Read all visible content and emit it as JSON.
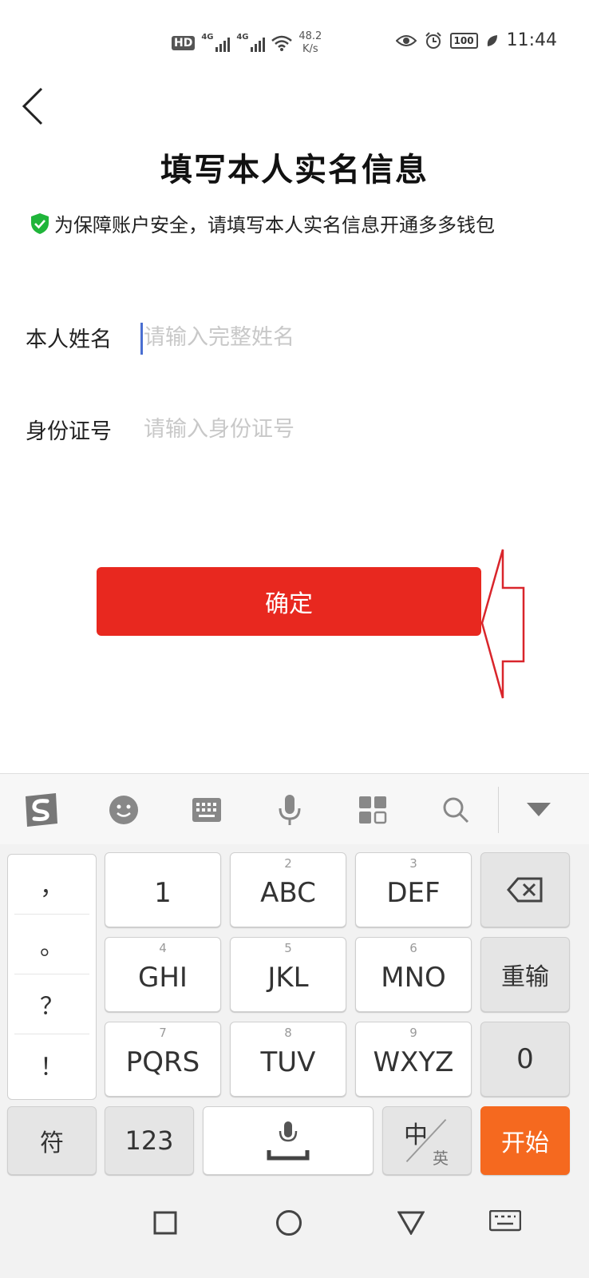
{
  "status_bar": {
    "hd": "HD",
    "net1": "4G",
    "net2": "4G",
    "speed_value": "48.2",
    "speed_unit": "K/s",
    "battery": "100",
    "time": "11:44"
  },
  "header": {
    "title": "填写本人实名信息",
    "notice": "为保障账户安全，请填写本人实名信息开通多多钱包"
  },
  "form": {
    "name_label": "本人姓名",
    "name_placeholder": "请输入完整姓名",
    "name_value": "",
    "id_label": "身份证号",
    "id_placeholder": "请输入身份证号",
    "id_value": ""
  },
  "confirm_label": "确定",
  "keyboard": {
    "toolbar_icons": [
      "sogou-logo-icon",
      "emoji-icon",
      "keyboard-icon",
      "microphone-icon",
      "apps-grid-icon",
      "search-icon",
      "collapse-icon"
    ],
    "punctuation": [
      "，",
      "。",
      "？",
      "！"
    ],
    "keys": [
      {
        "num": "",
        "label": "1"
      },
      {
        "num": "2",
        "label": "ABC"
      },
      {
        "num": "3",
        "label": "DEF"
      },
      {
        "num": "4",
        "label": "GHI"
      },
      {
        "num": "5",
        "label": "JKL"
      },
      {
        "num": "6",
        "label": "MNO"
      },
      {
        "num": "7",
        "label": "PQRS"
      },
      {
        "num": "8",
        "label": "TUV"
      },
      {
        "num": "9",
        "label": "WXYZ"
      }
    ],
    "reinput": "重输",
    "zero": "0",
    "symbols": "符",
    "numbers": "123",
    "lang_main": "中",
    "lang_alt": "英",
    "start": "开始"
  },
  "colors": {
    "accent_red": "#e8281f",
    "enter_orange": "#f5691f",
    "caret_blue": "#4a6fd1",
    "shield_green": "#1fb53a"
  }
}
